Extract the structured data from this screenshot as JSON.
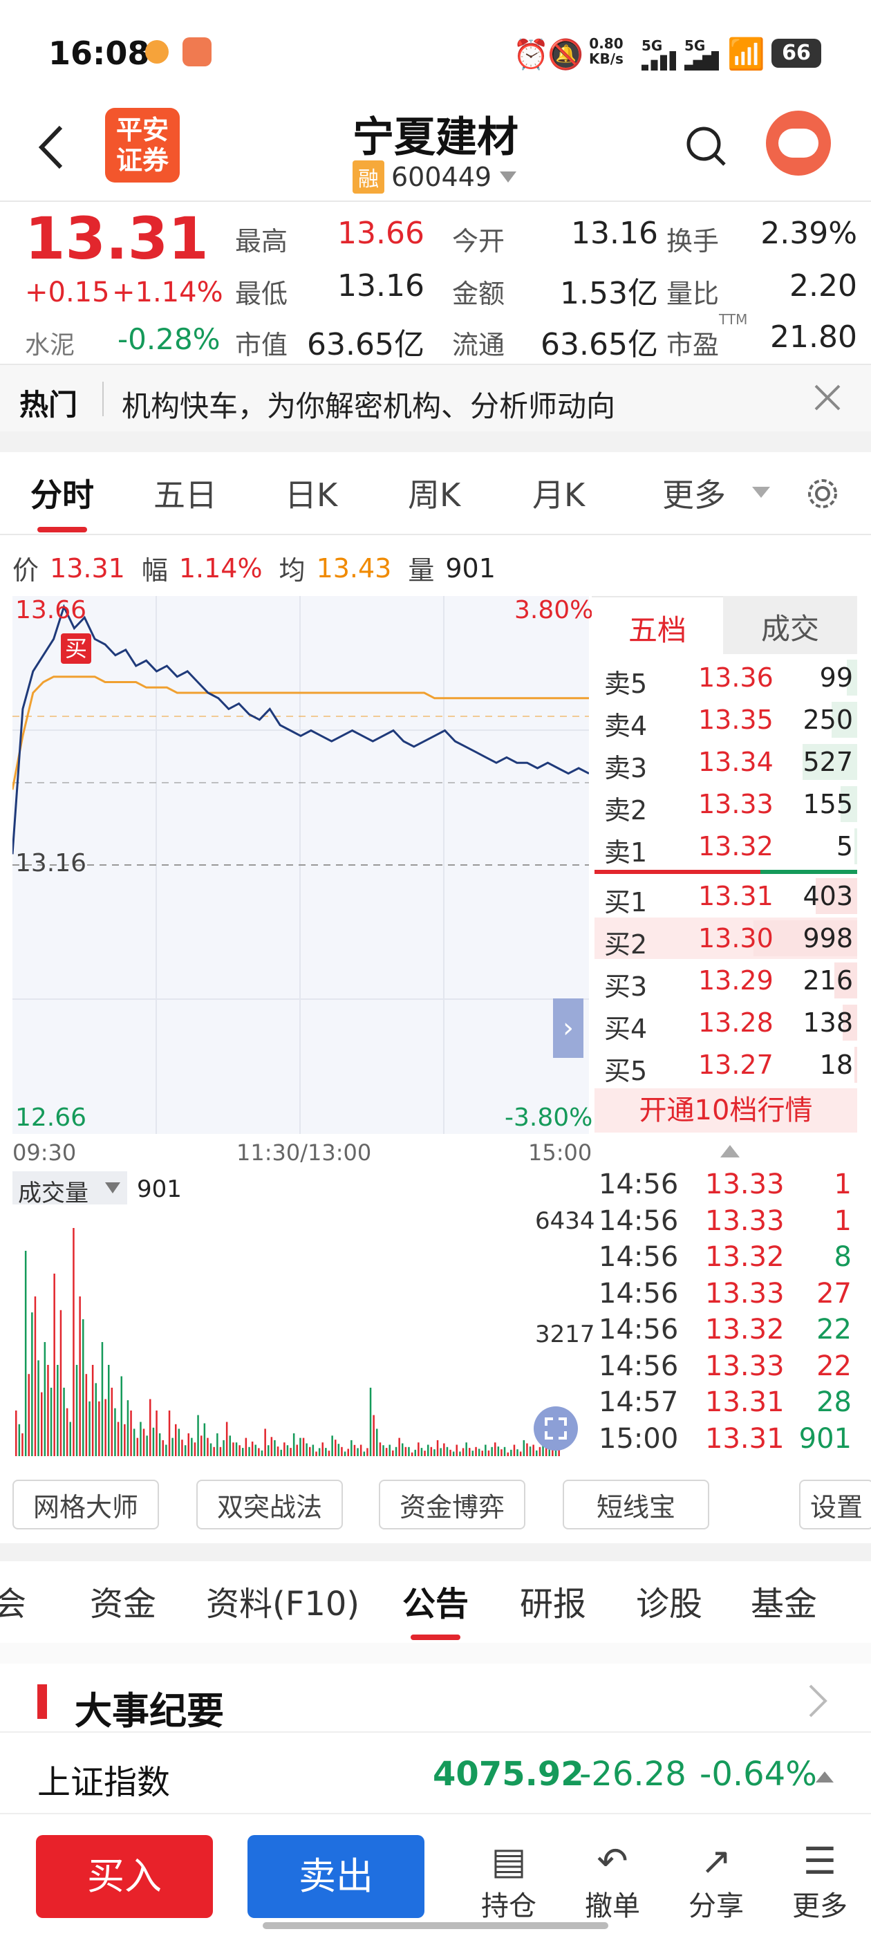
{
  "status_bar": {
    "time": "16:08",
    "net_speed_value": "0.80",
    "net_speed_unit": "KB/s",
    "sim1": "5G",
    "sim2": "5G",
    "battery": "66"
  },
  "header": {
    "broker_logo_line1": "平安",
    "broker_logo_line2": "证券",
    "stock_name": "宁夏建材",
    "margin_badge": "融",
    "stock_code": "600449"
  },
  "quote": {
    "price": "13.31",
    "change": "+0.15",
    "change_pct": "+1.14%",
    "sector_name": "水泥",
    "sector_change": "-0.28%",
    "fields": [
      {
        "label": "最高",
        "value": "13.66"
      },
      {
        "label": "今开",
        "value": "13.16"
      },
      {
        "label": "换手",
        "value": "2.39%"
      },
      {
        "label": "最低",
        "value": "13.16"
      },
      {
        "label": "金额",
        "value": "1.53亿"
      },
      {
        "label": "量比",
        "value": "2.20"
      },
      {
        "label": "市值",
        "value": "63.65亿"
      },
      {
        "label": "流通",
        "value": "63.65亿"
      },
      {
        "label": "市盈",
        "value": "21.80",
        "superscript": "TTM"
      }
    ]
  },
  "hot_banner": {
    "tag": "热门",
    "text": "机构快车，为你解密机构、分析师动向"
  },
  "chart_tabs": [
    "分时",
    "五日",
    "日K",
    "周K",
    "月K",
    "更多"
  ],
  "info_line": {
    "price_label": "价",
    "price": "13.31",
    "amp_label": "幅",
    "amp": "1.14%",
    "avg_label": "均",
    "avg": "13.43",
    "vol_label": "量",
    "vol": "901"
  },
  "intraday": {
    "top_price": "13.66",
    "top_pct": "3.80%",
    "mid_price": "13.16",
    "bottom_price": "12.66",
    "bottom_pct": "-3.80%",
    "buy_marker": "买",
    "time_labels": [
      "09:30",
      "11:30/13:00",
      "15:00"
    ]
  },
  "volume_panel": {
    "selector_label": "成交量",
    "value": "901",
    "max_label": "6434",
    "mid_label": "3217"
  },
  "order_book": {
    "tabs": [
      "五档",
      "成交"
    ],
    "asks": [
      {
        "label": "卖5",
        "price": "13.36",
        "vol": "99",
        "bar": 0.1
      },
      {
        "label": "卖4",
        "price": "13.35",
        "vol": "250",
        "bar": 0.25
      },
      {
        "label": "卖3",
        "price": "13.34",
        "vol": "527",
        "bar": 0.53
      },
      {
        "label": "卖2",
        "price": "13.33",
        "vol": "155",
        "bar": 0.16
      },
      {
        "label": "卖1",
        "price": "13.32",
        "vol": "5",
        "bar": 0.02
      }
    ],
    "bids": [
      {
        "label": "买1",
        "price": "13.31",
        "vol": "403",
        "bar": 0.4
      },
      {
        "label": "买2",
        "price": "13.30",
        "vol": "998",
        "bar": 1.0
      },
      {
        "label": "买3",
        "price": "13.29",
        "vol": "216",
        "bar": 0.22
      },
      {
        "label": "买4",
        "price": "13.28",
        "vol": "138",
        "bar": 0.14
      },
      {
        "label": "买5",
        "price": "13.27",
        "vol": "18",
        "bar": 0.02
      }
    ],
    "upgrade_button": "开通10档行情"
  },
  "trades": [
    {
      "time": "14:56",
      "price": "13.33",
      "vol": "1",
      "dir": "up"
    },
    {
      "time": "14:56",
      "price": "13.33",
      "vol": "1",
      "dir": "up"
    },
    {
      "time": "14:56",
      "price": "13.32",
      "vol": "8",
      "dir": "down"
    },
    {
      "time": "14:56",
      "price": "13.33",
      "vol": "27",
      "dir": "up"
    },
    {
      "time": "14:56",
      "price": "13.32",
      "vol": "22",
      "dir": "down"
    },
    {
      "time": "14:56",
      "price": "13.33",
      "vol": "22",
      "dir": "up"
    },
    {
      "time": "14:57",
      "price": "13.31",
      "vol": "28",
      "dir": "down"
    },
    {
      "time": "15:00",
      "price": "13.31",
      "vol": "901",
      "dir": "down"
    }
  ],
  "strategy_buttons": [
    "网格大师",
    "双突战法",
    "资金博弈",
    "短线宝"
  ],
  "settings_button": "设置",
  "bottom_tabs": [
    "会",
    "资金",
    "资料(F10)",
    "公告",
    "研报",
    "诊股",
    "基金"
  ],
  "section": {
    "title": "大事纪要"
  },
  "index_bar": {
    "name": "上证指数",
    "value": "4075.92",
    "change": "-26.28",
    "pct": "-0.64%"
  },
  "bottom_nav": {
    "buy": "买入",
    "sell": "卖出",
    "items": [
      "持仓",
      "撤单",
      "分享",
      "更多"
    ]
  },
  "colors": {
    "up": "#e2262d",
    "down": "#159a5a",
    "price_line": "#1f3a7a",
    "avg_line": "#f0a030",
    "buy_button": "#e8222a",
    "sell_button": "#1f6fe0"
  },
  "chart_data": {
    "type": "line",
    "title": "",
    "ylim": [
      12.66,
      13.66
    ],
    "series": [
      {
        "values": [
          13.18,
          13.45,
          13.52,
          13.55,
          13.58,
          13.64,
          13.6,
          13.62,
          13.58,
          13.57,
          13.55,
          13.56,
          13.53,
          13.54,
          13.52,
          13.53,
          13.51,
          13.52,
          13.5,
          13.48,
          13.47,
          13.45,
          13.46,
          13.44,
          13.43,
          13.45,
          13.42,
          13.41,
          13.4,
          13.41,
          13.4,
          13.39,
          13.4,
          13.41,
          13.4,
          13.39,
          13.4,
          13.41,
          13.39,
          13.38,
          13.39,
          13.4,
          13.41,
          13.39,
          13.38,
          13.37,
          13.36,
          13.35,
          13.36,
          13.35,
          13.35,
          13.34,
          13.35,
          13.34,
          13.33,
          13.34,
          13.33
        ]
      },
      {
        "values": [
          13.3,
          13.4,
          13.48,
          13.5,
          13.51,
          13.51,
          13.51,
          13.51,
          13.51,
          13.5,
          13.5,
          13.5,
          13.5,
          13.49,
          13.49,
          13.49,
          13.48,
          13.48,
          13.48,
          13.48,
          13.48,
          13.48,
          13.48,
          13.48,
          13.48,
          13.48,
          13.48,
          13.48,
          13.48,
          13.48,
          13.48,
          13.48,
          13.48,
          13.48,
          13.48,
          13.48,
          13.48,
          13.48,
          13.48,
          13.48,
          13.48,
          13.47,
          13.47,
          13.47,
          13.47,
          13.47,
          13.47,
          13.47,
          13.47,
          13.47,
          13.47,
          13.47,
          13.47,
          13.47,
          13.47,
          13.47,
          13.47
        ]
      }
    ],
    "volume": [
      0.2,
      0.9,
      0.7,
      0.5,
      0.8,
      0.3,
      1.0,
      0.6,
      0.4,
      0.5,
      0.3,
      0.35,
      0.2,
      0.15,
      0.25,
      0.1,
      0.2,
      0.12,
      0.1,
      0.18,
      0.08,
      0.1,
      0.15,
      0.06,
      0.08,
      0.05,
      0.12,
      0.07,
      0.06,
      0.1,
      0.08,
      0.05,
      0.06,
      0.09,
      0.04,
      0.07,
      0.05,
      0.3,
      0.06,
      0.05,
      0.08,
      0.04,
      0.06,
      0.05,
      0.07,
      0.04,
      0.05,
      0.06,
      0.04,
      0.05,
      0.06,
      0.04,
      0.05,
      0.07,
      0.05,
      0.06,
      0.15
    ]
  }
}
